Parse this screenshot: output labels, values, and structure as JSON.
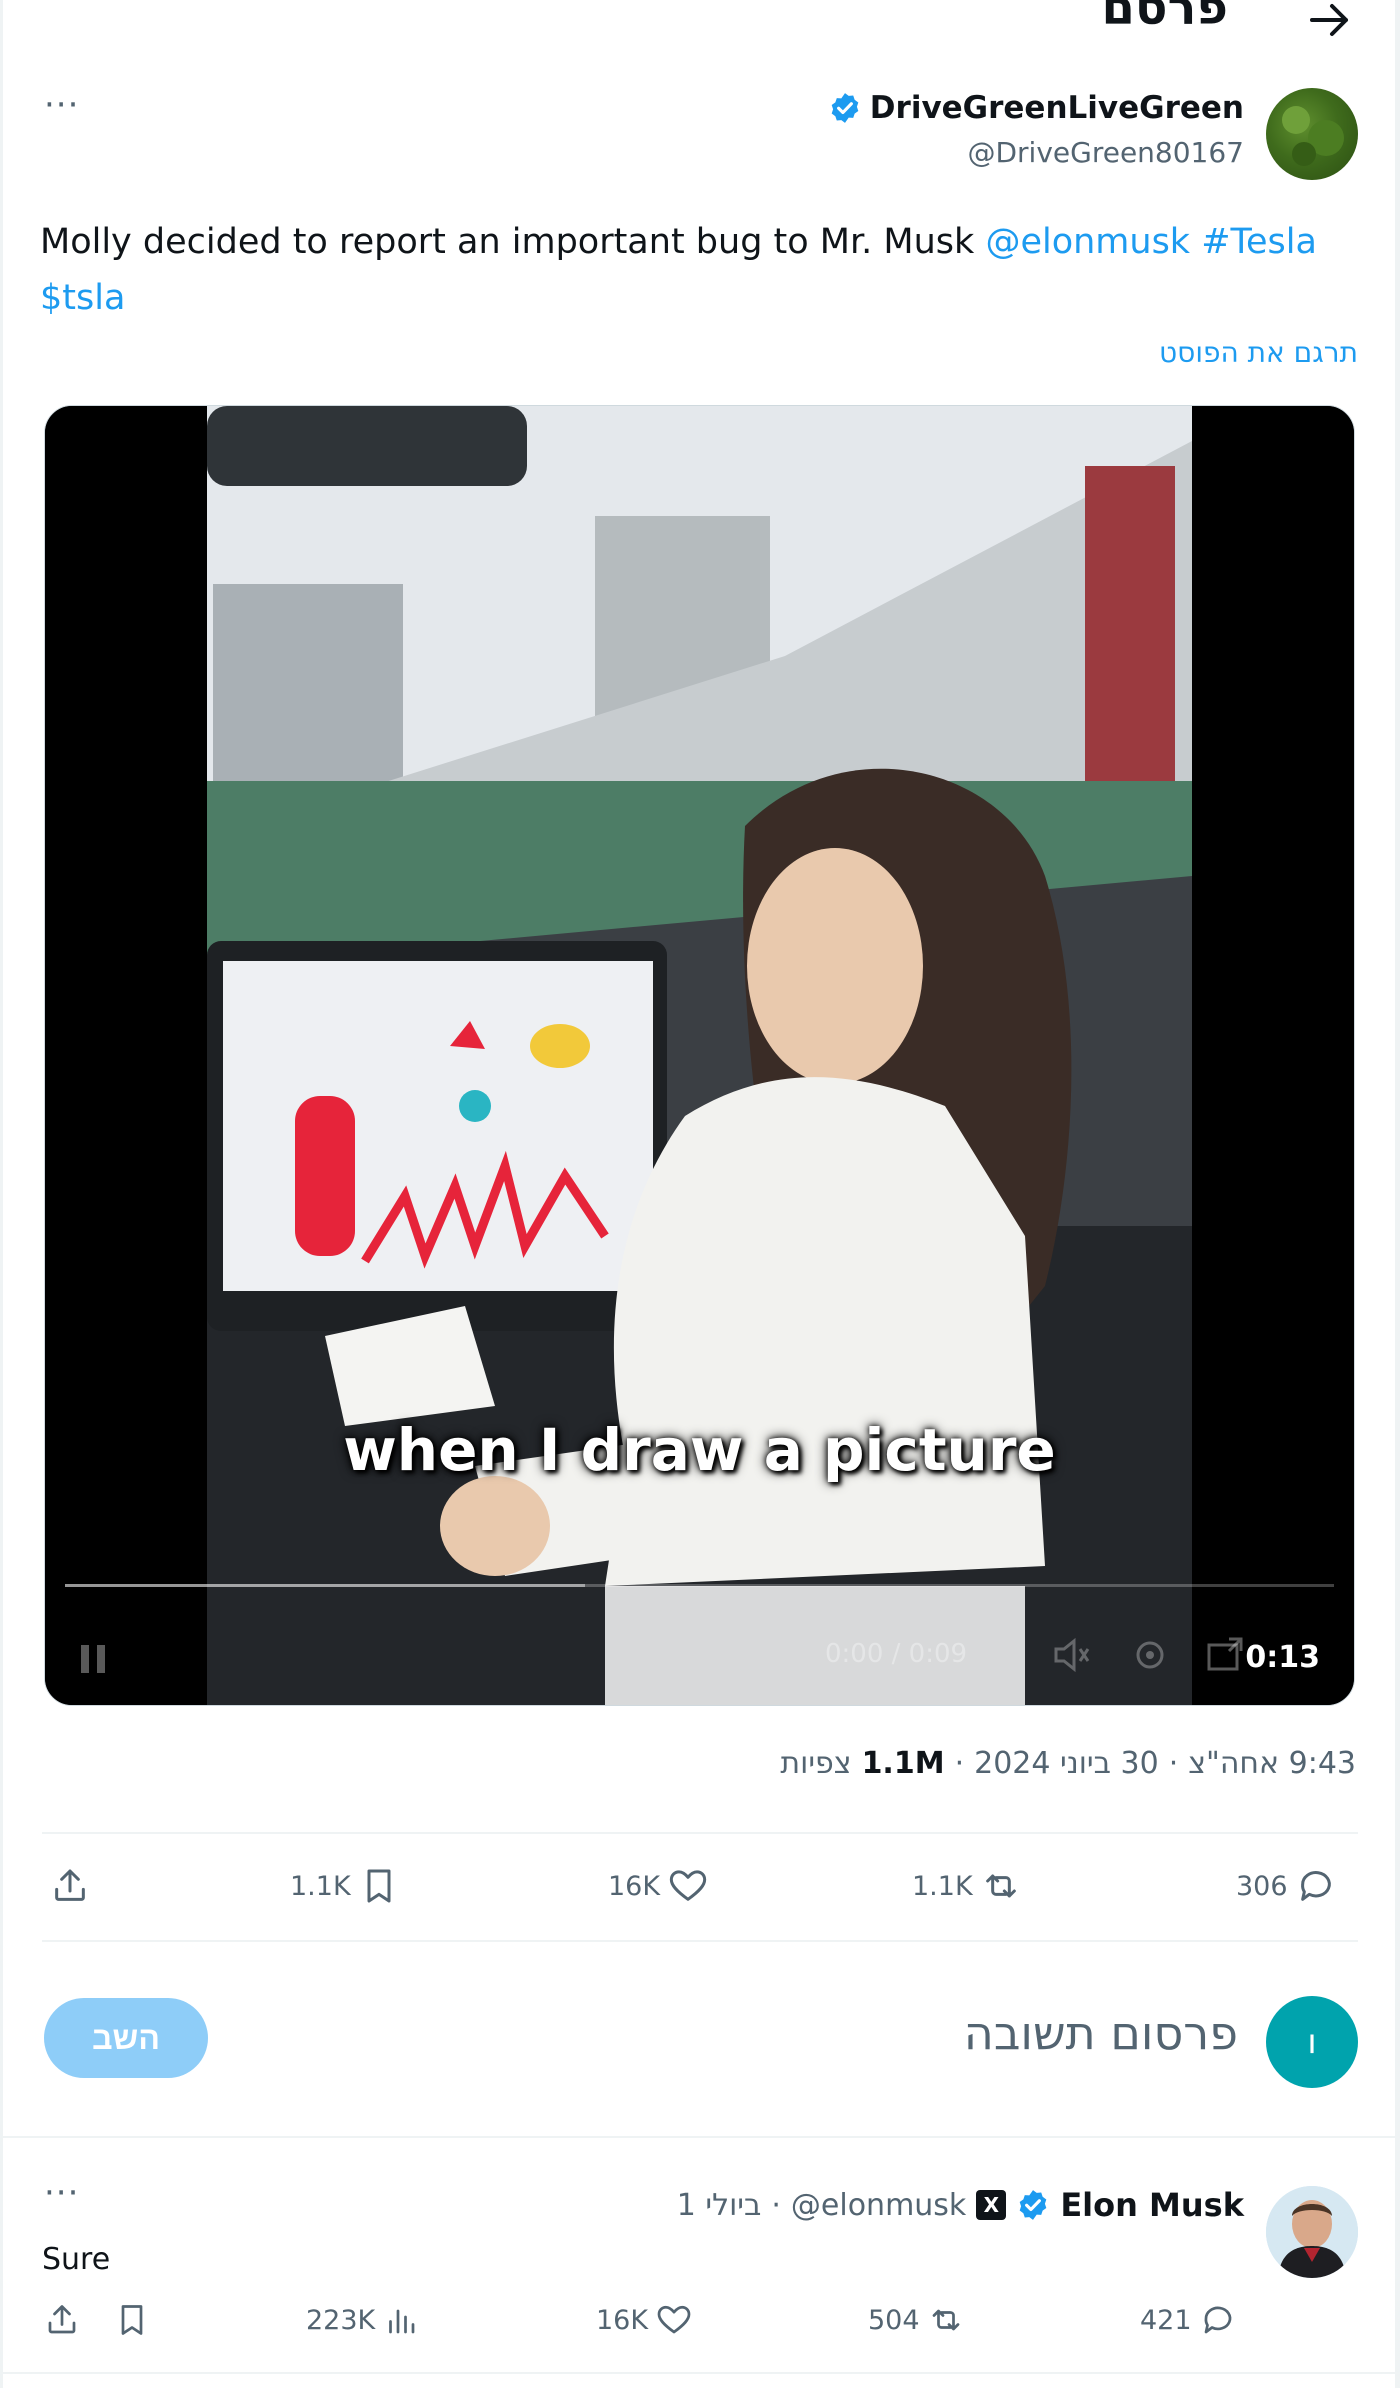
{
  "header": {
    "title": "פרסם"
  },
  "post": {
    "author_name": "DriveGreenLiveGreen",
    "author_handle": "@DriveGreen80167",
    "more": "···",
    "text_main": "Molly decided to report an important bug to Mr. Musk ",
    "mention": "@elonmusk",
    "hashtag": "#Tesla",
    "cashtag": "$tsla",
    "translate_label": "תרגם את הפוסט",
    "video": {
      "caption": "when I draw a picture",
      "duration": "0:13",
      "faint_time": "0:00 / 0:09",
      "progress": 0.41
    },
    "meta": {
      "time": "9:43 אחה\"צ",
      "date": "30 ביוני 2024",
      "views_value": "1.1M",
      "views_label": "צפיות"
    },
    "stats": {
      "replies": "306",
      "reposts": "1.1K",
      "likes": "16K",
      "bookmarks": "1.1K"
    }
  },
  "reply_box": {
    "avatar_letter": "ו",
    "placeholder": "פרסום תשובה",
    "button": "השב"
  },
  "reply": {
    "name": "Elon Musk",
    "handle": "@elonmusk",
    "time": "1 ביולי",
    "text": "Sure",
    "more": "···",
    "stats": {
      "replies": "421",
      "reposts": "504",
      "likes": "16K",
      "views": "223K"
    }
  },
  "colors": {
    "accent": "#1d9bf0",
    "muted": "#536471",
    "reply_button": "#8ecdf8",
    "reply_avatar": "#00a3ad"
  }
}
